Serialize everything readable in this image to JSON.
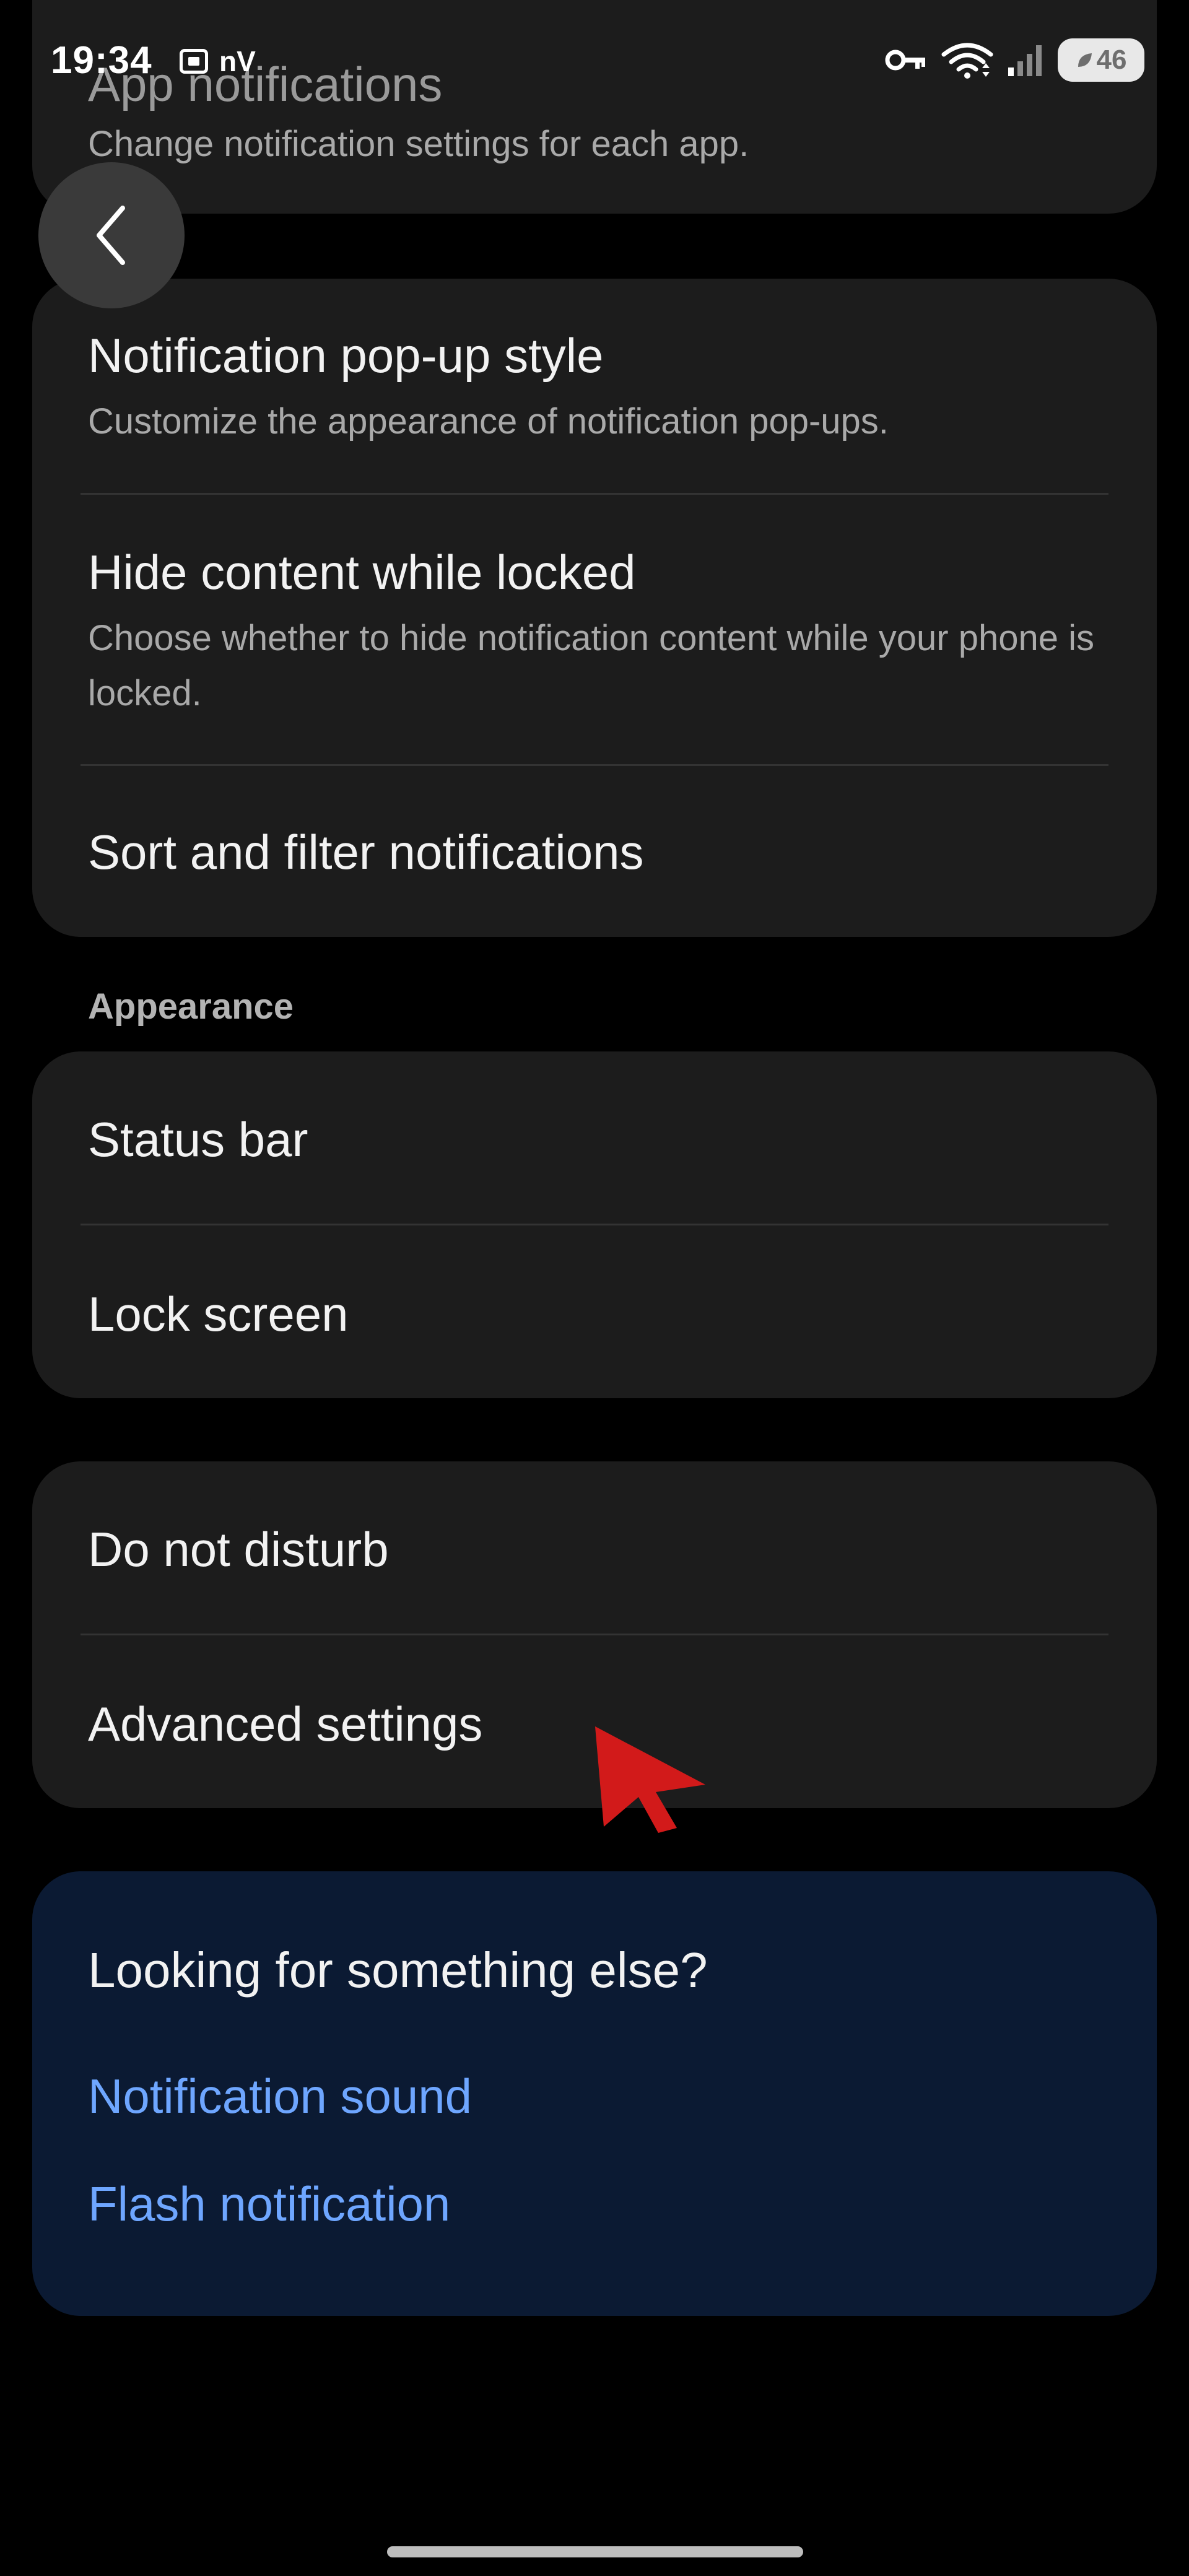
{
  "status_bar": {
    "time": "19:34",
    "left_indicator": "nV",
    "battery": "46",
    "icons": [
      "screenshot-icon",
      "key-icon",
      "wifi-icon",
      "signal-icon",
      "battery-icon"
    ]
  },
  "top_card": {
    "title": "App notifications",
    "subtitle": "Change notification settings for each app."
  },
  "card_a": {
    "items": [
      {
        "title": "Notification pop-up style",
        "subtitle": "Customize the appearance of notification pop-ups."
      },
      {
        "title": "Hide content while locked",
        "subtitle": "Choose whether to hide notification content while your phone is locked."
      },
      {
        "title": "Sort and filter notifications"
      }
    ]
  },
  "appearance": {
    "label": "Appearance",
    "items": [
      {
        "title": "Status bar"
      },
      {
        "title": "Lock screen"
      }
    ]
  },
  "card_c": {
    "items": [
      {
        "title": "Do not disturb"
      },
      {
        "title": "Advanced settings"
      }
    ]
  },
  "suggestions": {
    "title": "Looking for something else?",
    "links": [
      "Notification sound",
      "Flash notification"
    ]
  },
  "colors": {
    "background": "#000000",
    "card": "#1c1c1c",
    "suggest_card": "#0b1a33",
    "link": "#6ea6ff",
    "cursor": "#d21a1a"
  }
}
